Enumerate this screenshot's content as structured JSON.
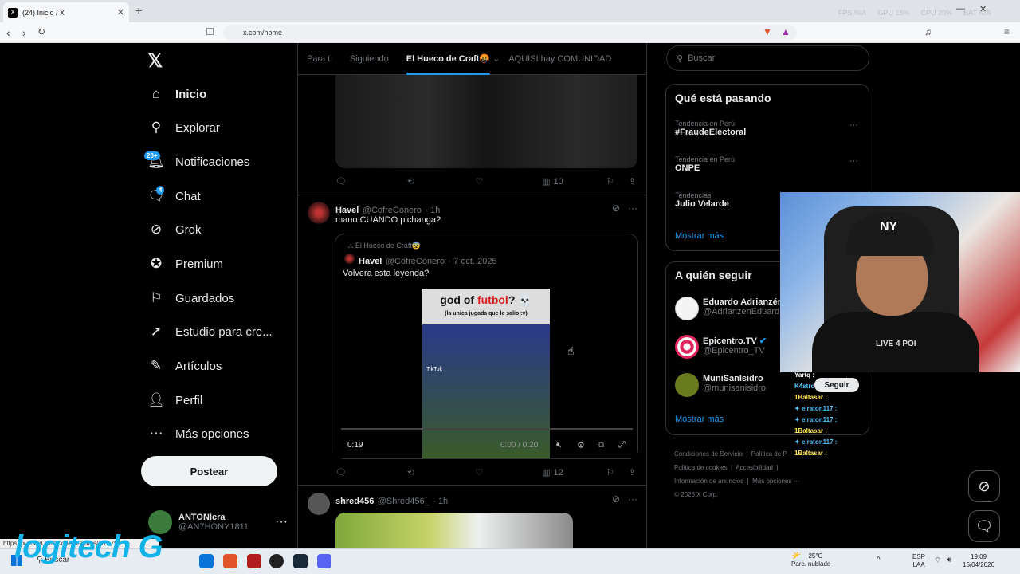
{
  "browser": {
    "tab_title": "(24) Inicio / X",
    "url": "x.com/home",
    "status_url": "https://x.com/CofreConero/status/20...791",
    "stats": [
      {
        "k": "FPS",
        "v": "N/A"
      },
      {
        "k": "GPU",
        "v": "15%"
      },
      {
        "k": "CPU",
        "v": "20%"
      },
      {
        "k": "BAT",
        "v": "N/A"
      }
    ]
  },
  "nav": {
    "items": [
      {
        "label": "Inicio",
        "icon": "home-icon"
      },
      {
        "label": "Explorar",
        "icon": "search-icon"
      },
      {
        "label": "Notificaciones",
        "icon": "bell-icon",
        "badge": "20+"
      },
      {
        "label": "Chat",
        "icon": "chat-icon",
        "badge": "4"
      },
      {
        "label": "Grok",
        "icon": "grok-icon"
      },
      {
        "label": "Premium",
        "icon": "premium-icon"
      },
      {
        "label": "Guardados",
        "icon": "bookmark-icon"
      },
      {
        "label": "Estudio para cre...",
        "icon": "rocket-icon"
      },
      {
        "label": "Artículos",
        "icon": "article-icon"
      },
      {
        "label": "Perfil",
        "icon": "person-icon"
      },
      {
        "label": "Más opciones",
        "icon": "more-icon"
      }
    ],
    "post_label": "Postear"
  },
  "account": {
    "name": "ANTONIcra",
    "handle": "@AN7HONY1811"
  },
  "feed_tabs": [
    "Para ti",
    "Siguiendo",
    "El Hueco de Craft🤬",
    "AQUISI hay COMUNIDAD"
  ],
  "tweet1": {
    "views": "10"
  },
  "tweet2": {
    "name": "Havel",
    "handle": "@CofreConero",
    "time": "· 1h",
    "text": "mano CUANDO pichanga?",
    "views": "12",
    "quote": {
      "community": "El Hueco de Craft😨",
      "name": "Havel",
      "handle": "@CofreConero",
      "date": "· 7 oct. 2025",
      "text": "Volvera esta leyenda?",
      "video_title_a": "god of ",
      "video_title_b": "futbol",
      "video_title_c": "? 💀",
      "video_sub": "(la unica jugada que le salio :v)",
      "time_left": "0:19",
      "time_total": "0:00 / 0:20",
      "tiktok": "TikTok"
    }
  },
  "tweet3": {
    "name": "shred456",
    "handle": "@Shred456_",
    "time": "· 1h"
  },
  "search_placeholder": "Buscar",
  "trends": {
    "title": "Qué está pasando",
    "items": [
      {
        "meta": "Tendencia en Perú",
        "name": "#FraudeElectoral"
      },
      {
        "meta": "Tendencia en Perú",
        "name": "ONPE"
      },
      {
        "meta": "Tendencias",
        "name": "Julio Velarde"
      }
    ],
    "more": "Mostrar más"
  },
  "follow": {
    "title": "A quién seguir",
    "items": [
      {
        "name": "Eduardo Adrianzén",
        "handle": "@AdrianzenEduard"
      },
      {
        "name": "Epicentro.TV",
        "handle": "@Epicentro_TV"
      },
      {
        "name": "MuniSanIsidro",
        "handle": "@munisanisidro"
      }
    ],
    "more": "Mostrar más",
    "follow_btn": "Seguir"
  },
  "footer": {
    "links": [
      "Condiciones de Servicio",
      "Política de P",
      "Política de cookies",
      "Accesibilidad",
      "Información de anuncios",
      "Más opciones ···"
    ],
    "copyright": "© 2026 X Corp."
  },
  "chat_overlay": [
    {
      "user": "Yartq :",
      "cls": "w"
    },
    {
      "user": "K4stro",
      "cls": "v"
    },
    {
      "user": "1Baltasar :",
      "cls": "u"
    },
    {
      "user": "elraton117 :",
      "cls": "v"
    },
    {
      "user": "elraton117 :",
      "cls": "v"
    },
    {
      "user": "1Baltasar :",
      "cls": "u"
    },
    {
      "user": "elraton117 :",
      "cls": "v"
    },
    {
      "user": "1Baltasar :",
      "cls": "u"
    }
  ],
  "webcam": {
    "shirt_text": "LIVE 4 POI"
  },
  "overlay_logo": "logitech G",
  "taskbar": {
    "search": "Buscar",
    "weather_temp": "25°C",
    "weather_desc": "Parc. nublado",
    "lang": "ESP",
    "layout": "LAA",
    "time": "19:09",
    "date": "15/04/2026"
  }
}
